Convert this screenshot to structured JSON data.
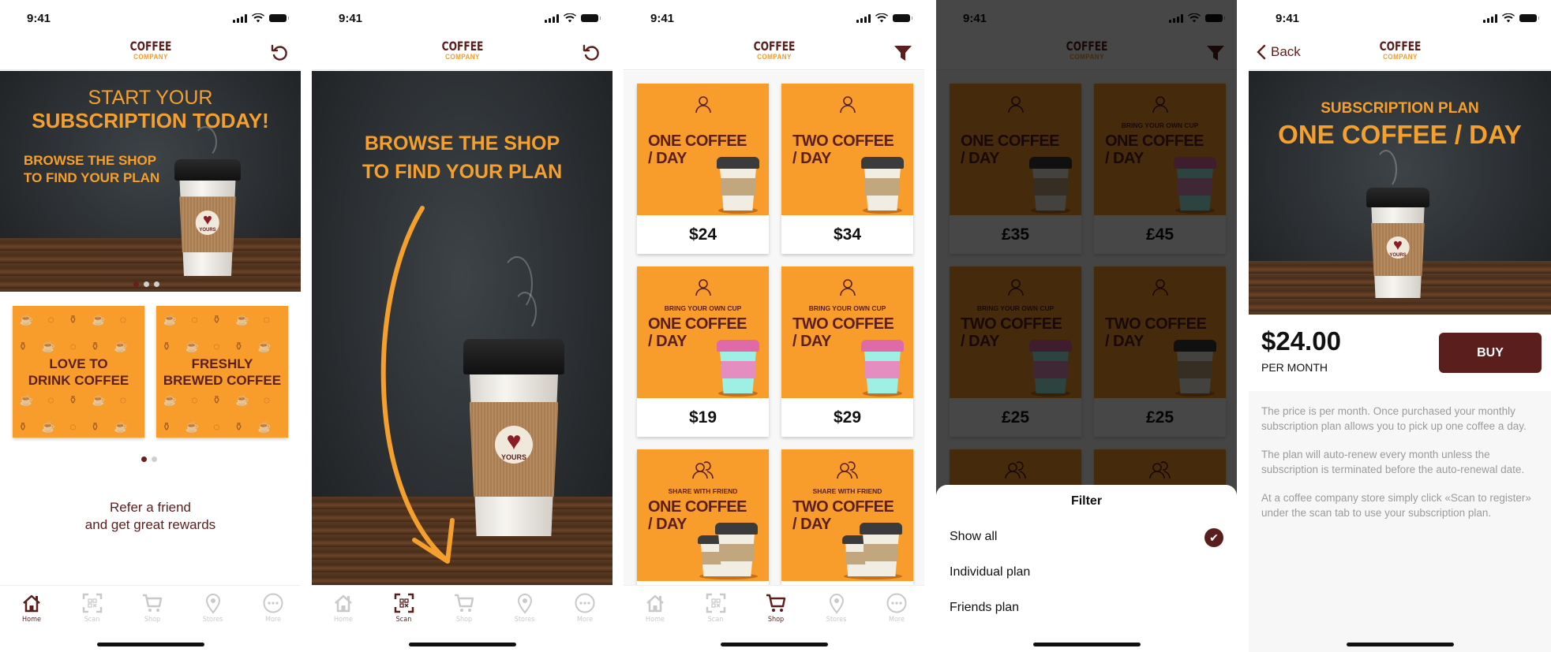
{
  "status_bar": {
    "time": "9:41"
  },
  "brand": {
    "line1": "COFFEE",
    "line2": "COMPANY",
    "primary": "#5a1f1d",
    "accent": "#f89c2c"
  },
  "tabs": [
    {
      "label": "Home",
      "icon": "home-icon"
    },
    {
      "label": "Scan",
      "icon": "qr-scan-icon"
    },
    {
      "label": "Shop",
      "icon": "cart-icon"
    },
    {
      "label": "Stores",
      "icon": "location-pin-icon"
    },
    {
      "label": "More",
      "icon": "more-icon"
    }
  ],
  "screens": {
    "home": {
      "active_tab": "Home",
      "nav_right_icon": "refresh-icon",
      "hero": {
        "line1": "START YOUR",
        "line2": "SUBSCRIPTION TODAY!",
        "line3": "BROWSE THE SHOP",
        "line4": "TO FIND YOUR PLAN",
        "cup_badge": "YOURS",
        "pages": 3,
        "current_page": 1
      },
      "promos": [
        {
          "line1": "LOVE TO",
          "line2": "DRINK COFFEE"
        },
        {
          "line1": "FRESHLY",
          "line2": "BREWED COFFEE"
        }
      ],
      "promo_pages": 2,
      "promo_current_page": 1,
      "refer": {
        "line1": "Refer a friend",
        "line2": "and get great rewards"
      }
    },
    "scan": {
      "active_tab": "Scan",
      "nav_right_icon": "refresh-icon",
      "hero": {
        "line1": "BROWSE THE SHOP",
        "line2": "TO FIND YOUR PLAN",
        "cup_badge": "YOURS"
      }
    },
    "shop": {
      "active_tab": "Shop",
      "nav_right_icon": "filter-icon",
      "cards": [
        {
          "icon": "user-icon",
          "subtitle": "",
          "title1": "ONE COFFEE",
          "title2": "/ DAY",
          "cup": "standard",
          "price": "$24"
        },
        {
          "icon": "user-icon",
          "subtitle": "",
          "title1": "TWO COFFEE",
          "title2": "/ DAY",
          "cup": "standard",
          "price": "$34"
        },
        {
          "icon": "user-icon",
          "subtitle": "BRING YOUR OWN CUP",
          "title1": "ONE COFFEE",
          "title2": "/ DAY",
          "cup": "reusable",
          "price": "$19"
        },
        {
          "icon": "user-icon",
          "subtitle": "BRING YOUR OWN CUP",
          "title1": "TWO COFFEE",
          "title2": "/ DAY",
          "cup": "reusable",
          "price": "$29"
        },
        {
          "icon": "users-icon",
          "subtitle": "SHARE WITH FRIEND",
          "title1": "ONE COFFEE",
          "title2": "/ DAY",
          "cup": "double",
          "price": ""
        },
        {
          "icon": "users-icon",
          "subtitle": "SHARE WITH FRIEND",
          "title1": "TWO COFFEE",
          "title2": "/ DAY",
          "cup": "double",
          "price": ""
        }
      ]
    },
    "filter": {
      "nav_right_icon": "filter-icon",
      "cards": [
        {
          "icon": "user-icon",
          "subtitle": "",
          "title1": "ONE COFFEE",
          "title2": "/ DAY",
          "cup": "standard",
          "price": "£35"
        },
        {
          "icon": "user-icon",
          "subtitle": "BRING YOUR OWN CUP",
          "title1": "ONE COFFEE",
          "title2": "/ DAY",
          "cup": "reusable",
          "price": "£45"
        },
        {
          "icon": "user-icon",
          "subtitle": "BRING YOUR OWN CUP",
          "title1": "TWO COFFEE",
          "title2": "/ DAY",
          "cup": "reusable",
          "price": "£25"
        },
        {
          "icon": "user-icon",
          "subtitle": "",
          "title1": "TWO COFFEE",
          "title2": "/ DAY",
          "cup": "standard",
          "price": "£25"
        },
        {
          "icon": "users-icon",
          "subtitle": "",
          "title1": "",
          "title2": "",
          "cup": "",
          "price": ""
        },
        {
          "icon": "users-icon",
          "subtitle": "",
          "title1": "",
          "title2": "",
          "cup": "",
          "price": ""
        }
      ],
      "sheet": {
        "title": "Filter",
        "options": [
          {
            "label": "Show all",
            "selected": true
          },
          {
            "label": "Individual plan",
            "selected": false
          },
          {
            "label": "Friends plan",
            "selected": false
          }
        ]
      }
    },
    "detail": {
      "back_label": "Back",
      "hero": {
        "line1": "SUBSCRIPTION PLAN",
        "line2": "ONE COFFEE / DAY",
        "cup_badge": "YOURS"
      },
      "price": "$24.00",
      "period": "PER MONTH",
      "buy_label": "BUY",
      "description": [
        "The price is per month. Once purchased your monthly subscription plan allows you to pick up one coffee a day.",
        "The plan will auto-renew every month unless the subscription is terminated before the auto-renewal date.",
        "At a coffee company store simply click «Scan to register» under the scan tab to use your subscription plan."
      ]
    }
  }
}
